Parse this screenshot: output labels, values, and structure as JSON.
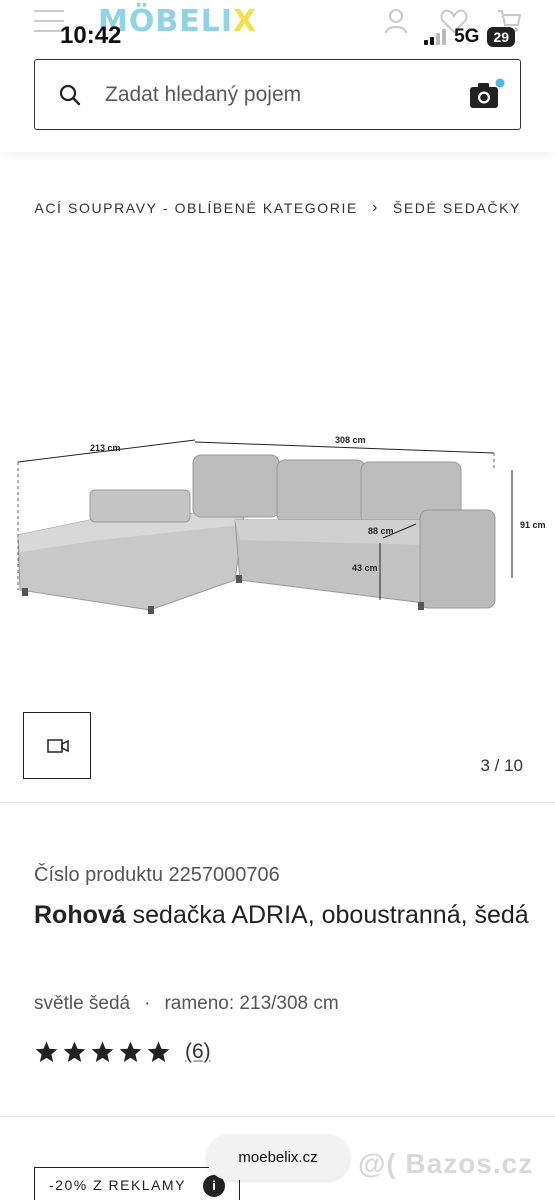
{
  "status_bar": {
    "time": "10:42",
    "network": "5G",
    "battery": "29"
  },
  "header": {
    "logo_main": "MÖBELI",
    "logo_x": "X",
    "search_placeholder": "Zadat hledaný pojem"
  },
  "breadcrumb": {
    "items": [
      "ACÍ SOUPRAVY - OBLÍBENÉ KATEGORIE",
      "ŠEDÉ SEDAČKY"
    ]
  },
  "product_image": {
    "dimensions": {
      "width_left": "213 cm",
      "width_main": "308 cm",
      "height": "91 cm",
      "depth": "88 cm",
      "seat_height": "43 cm"
    },
    "counter": "3 / 10"
  },
  "product": {
    "number": "Číslo produktu 2257000706",
    "title_bold": "Rohová",
    "title_rest": " sedačka ADRIA, oboustranná, šedá",
    "color": "světle šedá",
    "separator": "·",
    "arm": "rameno: 213/308 cm",
    "rating": 5,
    "review_count": "(6)"
  },
  "promo": {
    "label": "-20% Z REKLAMY",
    "info": "i"
  },
  "browser": {
    "url": "moebelix.cz"
  },
  "watermark": "@( Bazos.cz"
}
